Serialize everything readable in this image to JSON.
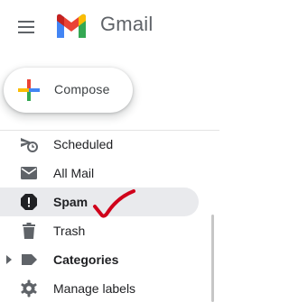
{
  "header": {
    "brand": "Gmail",
    "icons": {
      "menu": "hamburger-menu-icon",
      "logo": "gmail-logo"
    }
  },
  "compose": {
    "label": "Compose",
    "icon": "plus-multicolor-icon"
  },
  "nav": {
    "items": [
      {
        "label": "Scheduled",
        "icon": "scheduled-icon",
        "bold": false,
        "active": false
      },
      {
        "label": "All Mail",
        "icon": "mail-icon",
        "bold": false,
        "active": false
      },
      {
        "label": "Spam",
        "icon": "spam-icon",
        "bold": true,
        "active": true
      },
      {
        "label": "Trash",
        "icon": "trash-icon",
        "bold": false,
        "active": false
      },
      {
        "label": "Categories",
        "icon": "label-icon",
        "bold": true,
        "active": false,
        "expandable": true
      },
      {
        "label": "Manage labels",
        "icon": "gear-icon",
        "bold": false,
        "active": false
      }
    ]
  },
  "colors": {
    "gmail_red": "#ea4335",
    "gmail_blue": "#4285f4",
    "gmail_green": "#34a853",
    "gmail_yellow": "#fbbc04",
    "gmail_dark_red": "#c5221f",
    "active_row": "#e9eaed",
    "icon_gray": "#5f6368",
    "annotation_red": "#d0021b"
  }
}
